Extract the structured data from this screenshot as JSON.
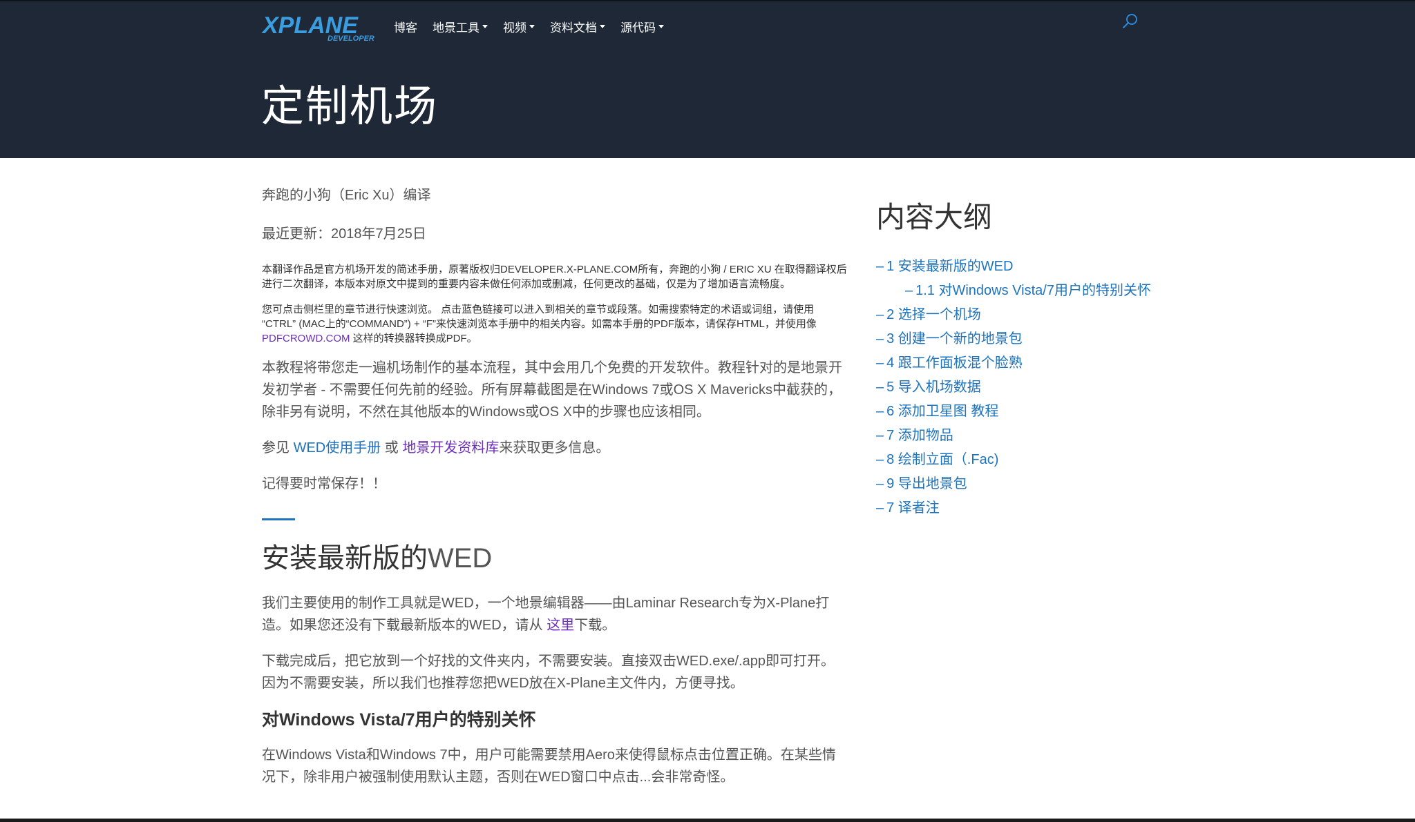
{
  "header": {
    "logo": {
      "main_text": "XPLANE",
      "sub_text": "DEVELOPER"
    },
    "nav": [
      {
        "label": "博客",
        "dropdown": false
      },
      {
        "label": "地景工具",
        "dropdown": true
      },
      {
        "label": "视频",
        "dropdown": true
      },
      {
        "label": "资料文档",
        "dropdown": true
      },
      {
        "label": "源代码",
        "dropdown": true
      }
    ],
    "search_icon": "search-icon",
    "title": "定制机场"
  },
  "main": {
    "author": "奔跑的小狗（Eric Xu）编译",
    "updated": "最近更新：2018年7月25日",
    "note1": "本翻译作品是官方机场开发的简述手册，原著版权归DEVELOPER.X-PLANE.COM所有，奔跑的小狗 / ERIC XU 在取得翻译权后进行二次翻译，本版本对原文中提到的重要内容未做任何添加或删减，任何更改的基础，仅是为了增加语言流畅度。",
    "note2_pre": "您可点击侧栏里的章节进行快速浏览。 点击蓝色链接可以进入到相关的章节或段落。如需搜索特定的术语或词组，请使用 “CTRL” (MAC上的“COMMAND”) + “F”来快速浏览本手册中的相关内容。如需本手册的PDF版本，请保存HTML，并使用像 ",
    "note2_link": "PDFCROWD.COM",
    "note2_post": " 这样的转换器转换成PDF。",
    "intro": "本教程将带您走一遍机场制作的基本流程，其中会用几个免费的开发软件。教程针对的是地景开发初学者 - 不需要任何先前的经验。所有屏幕截图是在Windows 7或OS X Mavericks中截获的，除非另有说明，不然在其他版本的Windows或OS X中的步骤也应该相同。",
    "see_pre": "参见 ",
    "see_link1": "WED使用手册",
    "see_mid": " 或 ",
    "see_link2": "地景开发资料库",
    "see_post": "来获取更多信息。",
    "remember": "记得要时常保存！！",
    "section1_title_cn": "安装最新版的",
    "section1_title_en": "WED",
    "section1_p1_pre": "我们主要使用的制作工具就是WED，一个地景编辑器——由Laminar Research专为X-Plane打造。如果您还没有下载最新版本的WED，请从 ",
    "section1_p1_link": "这里",
    "section1_p1_post": "下载。",
    "section1_p2": "下载完成后，把它放到一个好找的文件夹内，不需要安装。直接双击WED.exe/.app即可打开。因为不需要安装，所以我们也推荐您把WED放在X-Plane主文件内，方便寻找。",
    "subsection_title": "对Windows Vista/7用户的特别关怀",
    "subsection_p": "在Windows Vista和Windows 7中，用户可能需要禁用Aero来使得鼠标点击位置正确。在某些情况下，除非用户被强制使用默认主题，否则在WED窗口中点击...会非常奇怪。"
  },
  "toc": {
    "title": "内容大纲",
    "items": [
      {
        "label": "1 安装最新版的WED",
        "sub": false
      },
      {
        "label": "1.1 对Windows Vista/7用户的特别关怀",
        "sub": true
      },
      {
        "label": "2 选择一个机场",
        "sub": false
      },
      {
        "label": "3 创建一个新的地景包",
        "sub": false
      },
      {
        "label": "4 跟工作面板混个脸熟",
        "sub": false
      },
      {
        "label": "5 导入机场数据",
        "sub": false
      },
      {
        "label": "6 添加卫星图 教程",
        "sub": false
      },
      {
        "label": "7 添加物品",
        "sub": false
      },
      {
        "label": "8 绘制立面（.Fac)",
        "sub": false
      },
      {
        "label": "9 导出地景包",
        "sub": false
      },
      {
        "label": "7 译者注",
        "sub": false
      }
    ]
  },
  "colors": {
    "header_bg": "#1e2837",
    "link_blue": "#1e73be",
    "link_purple": "#6b2fb8",
    "logo_blue": "#3a9de0"
  }
}
